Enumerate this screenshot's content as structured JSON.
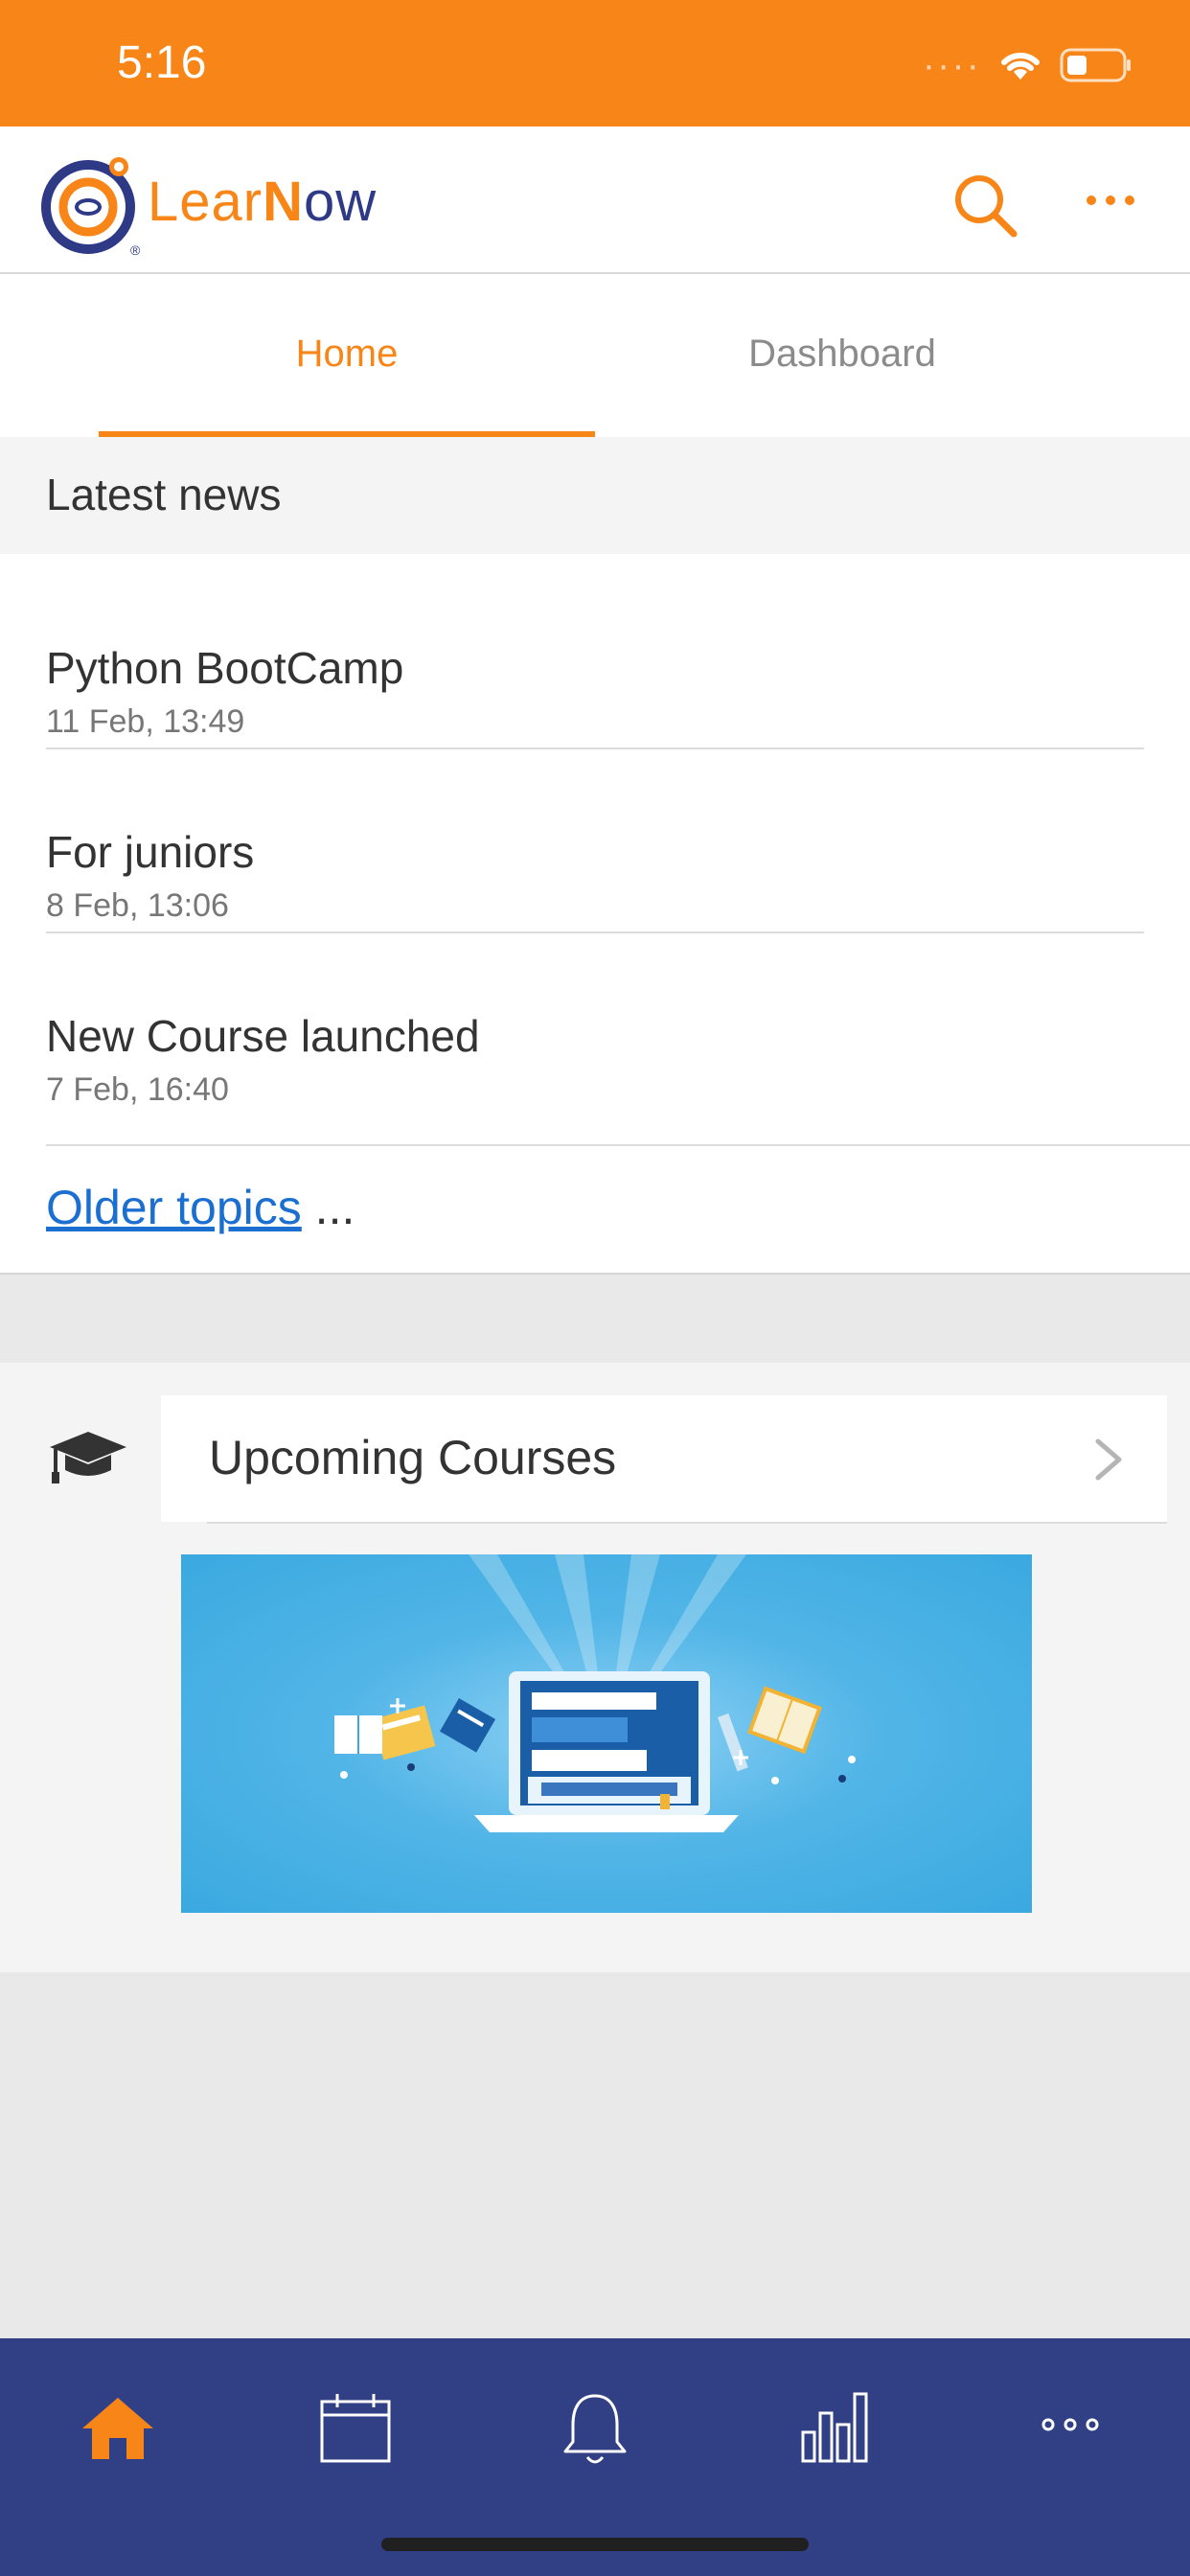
{
  "status_bar": {
    "time": "5:16"
  },
  "header": {
    "logo_text_1": "Lear",
    "logo_text_2": "N",
    "logo_text_3": "ow",
    "brand_color": "#f88517",
    "brand_dark": "#2e3a86"
  },
  "tabs": [
    {
      "label": "Home",
      "active": true
    },
    {
      "label": "Dashboard",
      "active": false
    }
  ],
  "news": {
    "section_title": "Latest news",
    "items": [
      {
        "title": "Python BootCamp",
        "date": "11 Feb, 13:49"
      },
      {
        "title": "For juniors",
        "date": "8 Feb, 13:06"
      },
      {
        "title": "New Course launched",
        "date": "7 Feb, 16:40"
      }
    ],
    "older_link": "Older topics",
    "older_suffix": " ..."
  },
  "courses": {
    "title": "Upcoming Courses"
  },
  "bottom_nav": {
    "items": [
      "home-icon",
      "calendar-icon",
      "bell-icon",
      "chart-icon",
      "more-icon"
    ],
    "active_color": "#f88517",
    "color": "#ffffff",
    "background": "#314084"
  }
}
